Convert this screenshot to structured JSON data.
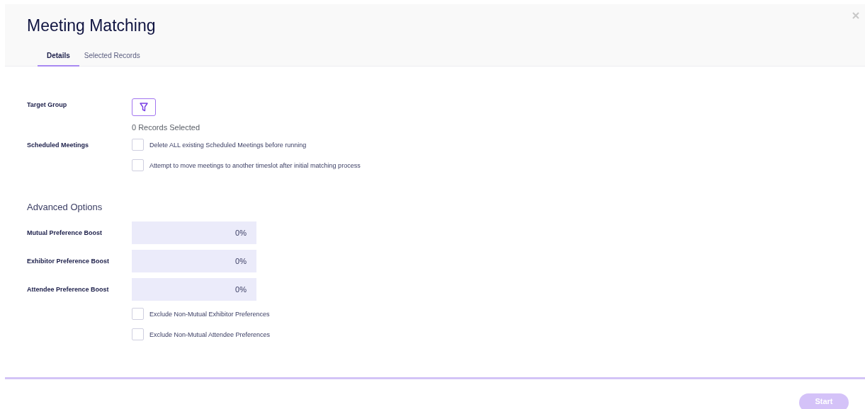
{
  "dialog": {
    "title": "Meeting Matching"
  },
  "tabs": [
    {
      "label": "Details",
      "selected": true
    },
    {
      "label": "Selected Records",
      "selected": false
    }
  ],
  "target_group": {
    "label": "Target Group",
    "records_selected": "0 Records Selected"
  },
  "scheduled_meetings": {
    "label": "Scheduled Meetings",
    "options": [
      {
        "label": "Delete ALL existing Scheduled Meetings before running",
        "checked": false
      },
      {
        "label": "Attempt to move meetings to another timeslot after initial matching process",
        "checked": false
      }
    ]
  },
  "advanced_options": {
    "heading": "Advanced Options",
    "boosts": [
      {
        "label": "Mutual Preference Boost",
        "value": "0%"
      },
      {
        "label": "Exhibitor Preference Boost",
        "value": "0%"
      },
      {
        "label": "Attendee Preference Boost",
        "value": "0%"
      }
    ],
    "options": [
      {
        "label": "Exclude Non-Mutual Exhibitor Preferences",
        "checked": false
      },
      {
        "label": "Exclude Non-Mutual Attendee Preferences",
        "checked": false
      }
    ]
  },
  "start_button": {
    "label": "Start",
    "disabled": true
  }
}
